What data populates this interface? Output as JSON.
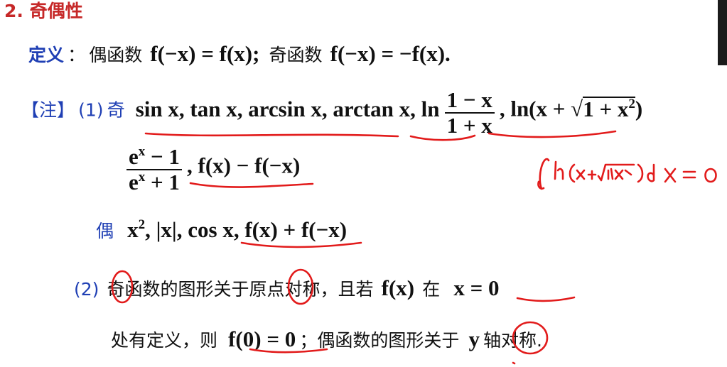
{
  "heading": "2. 奇偶性",
  "definition": {
    "label": "定义",
    "colon": "：",
    "even_label": "偶函数",
    "even_formula": "f(−x) = f(x);",
    "odd_label": "奇函数",
    "odd_formula": "f(−x) = −f(x)."
  },
  "note": {
    "label": "【注】",
    "item1_prefix": "(1)",
    "odd_word": "奇",
    "odd_functions": "sin x, tan x, arcsin x, arctan x, ln",
    "frac1_num": "1 − x",
    "frac1_den": "1 + x",
    "ln_sqrt_start": ", ln(x + √",
    "sqrt_inner": "1 + x",
    "sqrt_exp": "2",
    "ln_sqrt_end": ")",
    "frac2_num": "e",
    "frac2_num_exp": "x",
    "frac2_num_tail": " − 1",
    "frac2_den": "e",
    "frac2_den_exp": "x",
    "frac2_den_tail": " + 1",
    "odd_extra": ", f(x) − f(−x)",
    "even_word": "偶",
    "even_x": "x",
    "even_x_exp": "2",
    "even_rest": ", |x|, cos x, f(x) + f(−x)",
    "item2_prefix": "(2)",
    "item2_text_a": "奇函数的图形关于原点对称，且若",
    "item2_fx": "f(x)",
    "item2_text_b": "在",
    "item2_x0": "x = 0",
    "item2_line2_a": "处有定义，则",
    "item2_f0": "f(0) = 0",
    "item2_line2_b": "；偶函数的图形关于",
    "item2_y": "y",
    "item2_line2_c": "轴对称."
  },
  "handwriting": {
    "note": "∫₋₁¹ ln(x+√(1+x²)) dx = 0"
  },
  "colors": {
    "heading": "#c62828",
    "label_blue": "#1f3fb4",
    "annotation_red": "#e21b1b"
  }
}
